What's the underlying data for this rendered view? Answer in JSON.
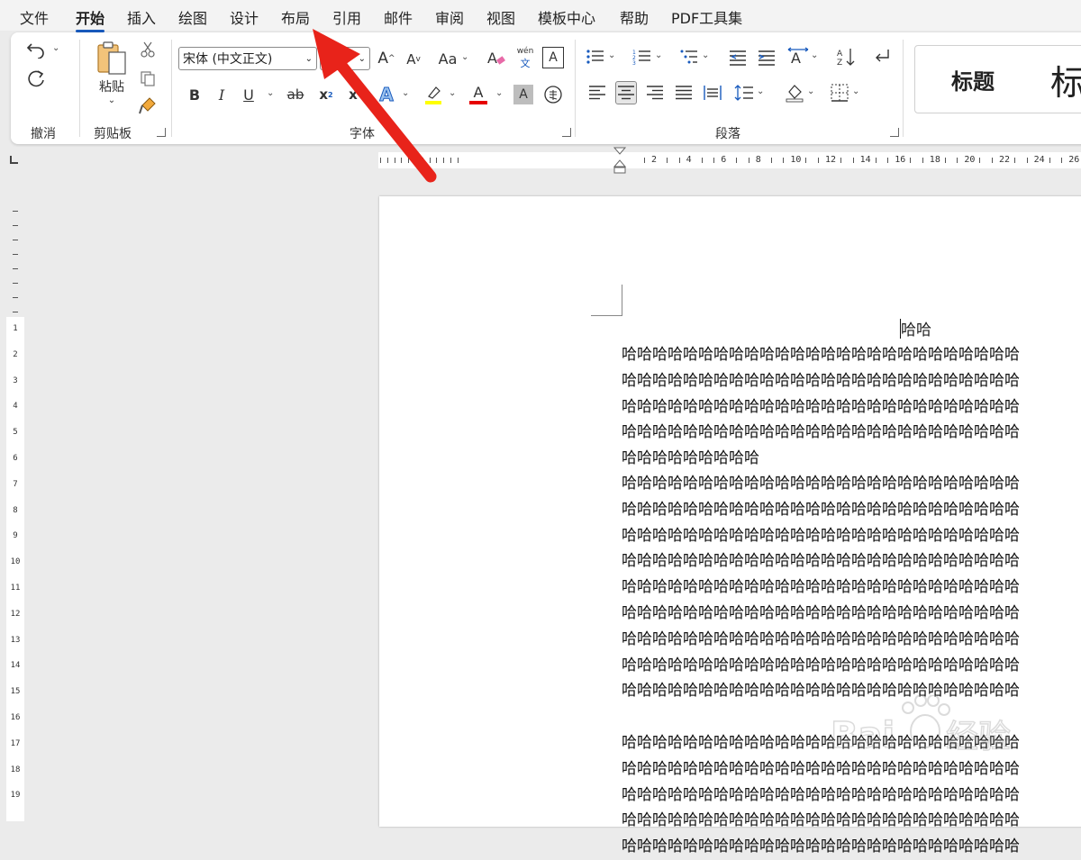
{
  "menu": {
    "tabs": [
      "文件",
      "开始",
      "插入",
      "绘图",
      "设计",
      "布局",
      "引用",
      "邮件",
      "审阅",
      "视图",
      "模板中心",
      "帮助",
      "PDF工具集"
    ],
    "active": "开始"
  },
  "ribbon": {
    "undo_group": "撤消",
    "clipboard_group": "剪贴板",
    "paste_label": "粘贴",
    "font_group": "字体",
    "paragraph_group": "段落",
    "font_name": "宋体 (中文正文)",
    "styles": {
      "heading_label": "标题",
      "heading_partial": "标"
    },
    "btn_bold": "B",
    "btn_italic": "I",
    "btn_underline": "U",
    "btn_strike": "ab",
    "btn_sub": "x",
    "btn_sub_mark": "2",
    "btn_sup": "x",
    "btn_font_color": "A",
    "btn_char_shading": "A",
    "btn_grow": "A",
    "btn_shrink": "A",
    "btn_case": "Aa",
    "btn_phonetic": "wén",
    "btn_phonetic_sub": "文",
    "btn_border": "A",
    "btn_text_effect": "A"
  },
  "ruler": {
    "h_numbers": [
      "2",
      "4",
      "6",
      "8",
      "10",
      "12",
      "14",
      "16",
      "18",
      "20",
      "22",
      "24",
      "26"
    ],
    "v_numbers": [
      "1",
      "2",
      "3",
      "4",
      "5",
      "6",
      "7",
      "8",
      "9",
      "10",
      "11",
      "12",
      "13",
      "14",
      "15",
      "16",
      "17",
      "18",
      "19"
    ]
  },
  "document": {
    "title": "哈哈",
    "para1": [
      "哈哈哈哈哈哈哈哈哈哈哈哈哈哈哈哈哈哈哈哈哈哈哈哈哈哈",
      "哈哈哈哈哈哈哈哈哈哈哈哈哈哈哈哈哈哈哈哈哈哈哈哈哈哈",
      "哈哈哈哈哈哈哈哈哈哈哈哈哈哈哈哈哈哈哈哈哈哈哈哈哈哈",
      "哈哈哈哈哈哈哈哈哈哈哈哈哈哈哈哈哈哈哈哈哈哈哈哈哈哈",
      "哈哈哈哈哈哈哈哈哈"
    ],
    "para2": [
      "哈哈哈哈哈哈哈哈哈哈哈哈哈哈哈哈哈哈哈哈哈哈哈哈哈哈",
      "哈哈哈哈哈哈哈哈哈哈哈哈哈哈哈哈哈哈哈哈哈哈哈哈哈哈",
      "哈哈哈哈哈哈哈哈哈哈哈哈哈哈哈哈哈哈哈哈哈哈哈哈哈哈",
      "哈哈哈哈哈哈哈哈哈哈哈哈哈哈哈哈哈哈哈哈哈哈哈哈哈哈",
      "哈哈哈哈哈哈哈哈哈哈哈哈哈哈哈哈哈哈哈哈哈哈哈哈哈哈",
      "哈哈哈哈哈哈哈哈哈哈哈哈哈哈哈哈哈哈哈哈哈哈哈哈哈哈",
      "哈哈哈哈哈哈哈哈哈哈哈哈哈哈哈哈哈哈哈哈哈哈哈哈哈哈",
      "哈哈哈哈哈哈哈哈哈哈哈哈哈哈哈哈哈哈哈哈哈哈哈哈哈哈",
      "哈哈哈哈哈哈哈哈哈哈哈哈哈哈哈哈哈哈哈哈哈哈哈哈哈哈",
      "哈哈哈哈哈哈哈哈哈哈哈哈哈哈哈哈哈哈哈哈哈哈哈哈哈哈",
      "哈哈哈哈哈哈哈哈哈哈哈哈哈哈哈哈哈哈哈哈哈哈哈哈哈哈",
      "哈哈哈哈哈哈哈哈哈哈哈哈哈哈哈哈哈哈哈哈哈哈哈哈哈哈",
      "哈哈哈哈哈哈哈哈哈哈哈哈哈哈哈哈哈哈哈哈哈哈哈哈哈哈",
      "哈哈哈哈哈哈哈哈哈哈哈哈哈哈哈哈哈哈哈哈哈哈哈哈哈哈"
    ]
  },
  "colors": {
    "accent": "#185abd",
    "arrow": "#e8231a",
    "highlight": "#ffff00",
    "font_color": "#e60000"
  }
}
